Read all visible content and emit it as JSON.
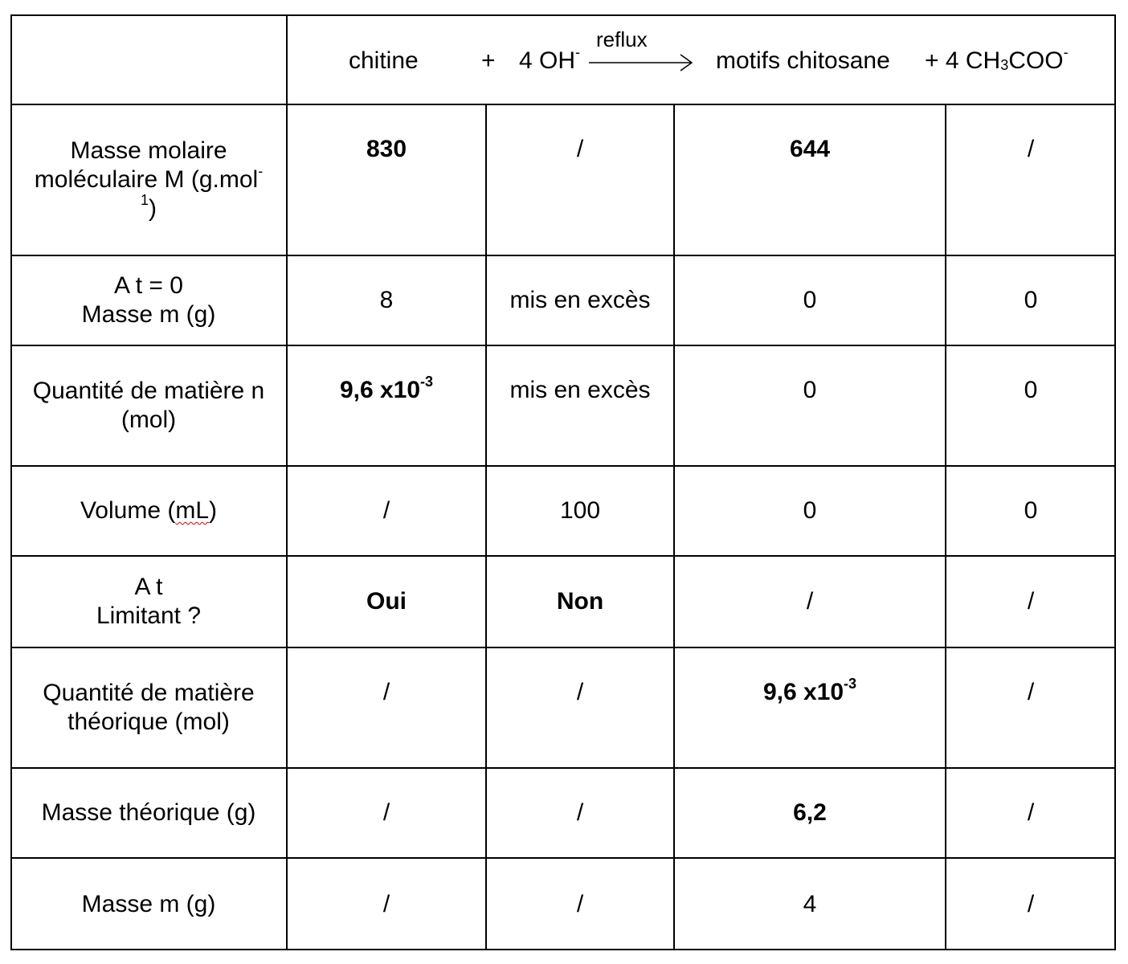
{
  "header": {
    "reactant1": "chitine",
    "plus1": "+",
    "reactant2": "4 OH",
    "reactant2_sup": "-",
    "condition": "reflux",
    "product1": "motifs chitosane",
    "product2_a": "+ 4 CH",
    "product2_sub": "3",
    "product2_b": "COO",
    "product2_sup": "-"
  },
  "rows": [
    {
      "label": [
        "Masse molaire",
        "moléculaire M (g.mol",
        "-",
        "1",
        ")"
      ],
      "cells": [
        {
          "t": "830",
          "b": true
        },
        {
          "t": "/"
        },
        {
          "t": "644",
          "b": true
        },
        {
          "t": "/"
        }
      ]
    },
    {
      "label": [
        "A t = 0",
        "Masse m (g)"
      ],
      "cells": [
        {
          "t": "8"
        },
        {
          "t": "mis en excès"
        },
        {
          "t": "0"
        },
        {
          "t": "0"
        }
      ]
    },
    {
      "label": [
        "Quantité de matière n",
        "(mol)"
      ],
      "cells": [
        {
          "t": "9,6 x10",
          "s": "-3",
          "b": true
        },
        {
          "t": "mis en excès"
        },
        {
          "t": "0"
        },
        {
          "t": "0"
        }
      ]
    },
    {
      "label": [
        "Volume (",
        "mL",
        ")"
      ],
      "cells": [
        {
          "t": "/"
        },
        {
          "t": "100"
        },
        {
          "t": "0"
        },
        {
          "t": "0"
        }
      ]
    },
    {
      "label": [
        "A t",
        "Limitant ?"
      ],
      "cells": [
        {
          "t": "Oui",
          "b": true
        },
        {
          "t": "Non",
          "b": true
        },
        {
          "t": "/"
        },
        {
          "t": "/"
        }
      ]
    },
    {
      "label": [
        "Quantité de matière",
        "théorique (mol)"
      ],
      "cells": [
        {
          "t": "/"
        },
        {
          "t": "/"
        },
        {
          "t": "9,6 x10",
          "s": "-3",
          "b": true
        },
        {
          "t": "/"
        }
      ]
    },
    {
      "label": [
        "Masse théorique (g)"
      ],
      "cells": [
        {
          "t": "/"
        },
        {
          "t": "/"
        },
        {
          "t": "6,2",
          "b": true
        },
        {
          "t": "/"
        }
      ]
    },
    {
      "label": [
        "Masse m (g)"
      ],
      "cells": [
        {
          "t": "/"
        },
        {
          "t": "/"
        },
        {
          "t": "4"
        },
        {
          "t": "/"
        }
      ]
    }
  ]
}
